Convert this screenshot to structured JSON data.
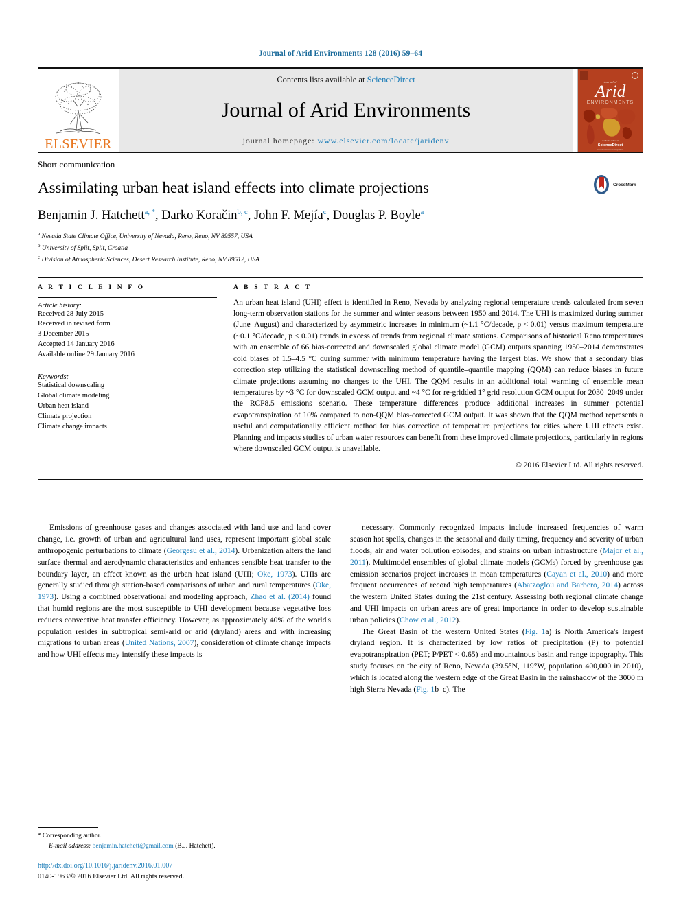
{
  "running_head": "Journal of Arid Environments 128 (2016) 59–64",
  "masthead": {
    "publisher_name": "ELSEVIER",
    "contents_prefix": "Contents lists available at ",
    "contents_link": "ScienceDirect",
    "journal_title": "Journal of Arid Environments",
    "homepage_label": "journal homepage: ",
    "homepage_url": "www.elsevier.com/locate/jaridenv",
    "cover_title_small": "Journal of",
    "cover_title_main": "Arid",
    "cover_subtitle": "ENVIRONMENTS",
    "cover_footer": "ScienceDirect"
  },
  "article": {
    "kicker": "Short communication",
    "title": "Assimilating urban heat island effects into climate projections",
    "crossmark_label": "CrossMark",
    "authors": [
      {
        "name": "Benjamin J. Hatchett",
        "marks": "a, *"
      },
      {
        "name": "Darko Koračin",
        "marks": "b, c"
      },
      {
        "name": "John F. Mejía",
        "marks": "c"
      },
      {
        "name": "Douglas P. Boyle",
        "marks": "a"
      }
    ],
    "affiliations": [
      {
        "mark": "a",
        "text": "Nevada State Climate Office, University of Nevada, Reno, Reno, NV 89557, USA"
      },
      {
        "mark": "b",
        "text": "University of Split, Split, Croatia"
      },
      {
        "mark": "c",
        "text": "Division of Atmospheric Sciences, Desert Research Institute, Reno, NV 89512, USA"
      }
    ]
  },
  "info_section": {
    "article_info_header": "A R T I C L E   I N F O",
    "abstract_header": "A B S T R A C T",
    "history_title": "Article history:",
    "history_lines": [
      "Received 28 July 2015",
      "Received in revised form",
      "3 December 2015",
      "Accepted 14 January 2016",
      "Available online 29 January 2016"
    ],
    "keywords_title": "Keywords:",
    "keywords": [
      "Statistical downscaling",
      "Global climate modeling",
      "Urban heat island",
      "Climate projection",
      "Climate change impacts"
    ],
    "abstract": "An urban heat island (UHI) effect is identified in Reno, Nevada by analyzing regional temperature trends calculated from seven long-term observation stations for the summer and winter seasons between 1950 and 2014. The UHI is maximized during summer (June–August) and characterized by asymmetric increases in minimum (~1.1 °C/decade, p < 0.01) versus maximum temperature (~0.1 °C/decade, p < 0.01) trends in excess of trends from regional climate stations. Comparisons of historical Reno temperatures with an ensemble of 66 bias-corrected and downscaled global climate model (GCM) outputs spanning 1950–2014 demonstrates cold biases of 1.5–4.5 °C during summer with minimum temperature having the largest bias. We show that a secondary bias correction step utilizing the statistical downscaling method of quantile–quantile mapping (QQM) can reduce biases in future climate projections assuming no changes to the UHI. The QQM results in an additional total warming of ensemble mean temperatures by ~3 °C for downscaled GCM output and ~4 °C for re-gridded 1° grid resolution GCM output for 2030–2049 under the RCP8.5 emissions scenario. These temperature differences produce additional increases in summer potential evapotranspiration of 10% compared to non-QQM bias-corrected GCM output. It was shown that the QQM method represents a useful and computationally efficient method for bias correction of temperature projections for cities where UHI effects exist. Planning and impacts studies of urban water resources can benefit from these improved climate projections, particularly in regions where downscaled GCM output is unavailable.",
    "copyright": "© 2016 Elsevier Ltd. All rights reserved."
  },
  "body": {
    "left_paragraph_html": "Emissions of greenhouse gases and changes associated with land use and land cover change, i.e. growth of urban and agricultural land uses, represent important global scale anthropogenic perturbations to climate (<span class=\"cit\">Georgesu et al., 2014</span>). Urbanization alters the land surface thermal and aerodynamic characteristics and enhances sensible heat transfer to the boundary layer, an effect known as the urban heat island (UHI; <span class=\"cit\">Oke, 1973</span>). UHIs are generally studied through station-based comparisons of urban and rural temperatures (<span class=\"cit\">Oke, 1973</span>). Using a combined observational and modeling approach, <span class=\"cit\">Zhao et al. (2014)</span> found that humid regions are the most susceptible to UHI development because vegetative loss reduces convective heat transfer efficiency. However, as approximately 40% of the world's population resides in subtropical semi-arid or arid (dryland) areas and with increasing migrations to urban areas (<span class=\"cit\">United Nations, 2007</span>), consideration of climate change impacts and how UHI effects may intensify these impacts is",
    "right_paragraph_1_html": "necessary. Commonly recognized impacts include increased frequencies of warm season hot spells, changes in the seasonal and daily timing, frequency and severity of urban floods, air and water pollution episodes, and strains on urban infrastructure (<span class=\"cit\">Major et al., 2011</span>). Multimodel ensembles of global climate models (GCMs) forced by greenhouse gas emission scenarios project increases in mean temperatures (<span class=\"cit\">Cayan et al., 2010</span>) and more frequent occurrences of record high temperatures (<span class=\"cit\">Abatzoglou and Barbero, 2014</span>) across the western United States during the 21st century. Assessing both regional climate change and UHI impacts on urban areas are of great importance in order to develop sustainable urban policies (<span class=\"cit\">Chow et al., 2012</span>).",
    "right_paragraph_2_html": "The Great Basin of the western United States (<span class=\"cit\">Fig. 1</span>a) is North America's largest dryland region. It is characterized by low ratios of precipitation (P) to potential evapotranspiration (PET; P/PET &lt; 0.65) and mountainous basin and range topography. This study focuses on the city of Reno, Nevada (39.5°N, 119°W, population 400,000 in 2010), which is located along the western edge of the Great Basin in the rainshadow of the 3000 m high Sierra Nevada (<span class=\"cit\">Fig. 1</span>b–c). The"
  },
  "footer": {
    "corresponding_star": "*",
    "corresponding_label": "Corresponding author.",
    "email_label": "E-mail address:",
    "email": "benjamin.hatchett@gmail.com",
    "email_suffix": "(B.J. Hatchett).",
    "doi": "http://dx.doi.org/10.1016/j.jaridenv.2016.01.007",
    "issn_line": "0140-1963/© 2016 Elsevier Ltd. All rights reserved."
  },
  "colors": {
    "link_blue": "#1a7cb8",
    "elsevier_orange": "#e87722",
    "banner_grey": "#e8e8e8",
    "cover_red": "#b5401f"
  }
}
